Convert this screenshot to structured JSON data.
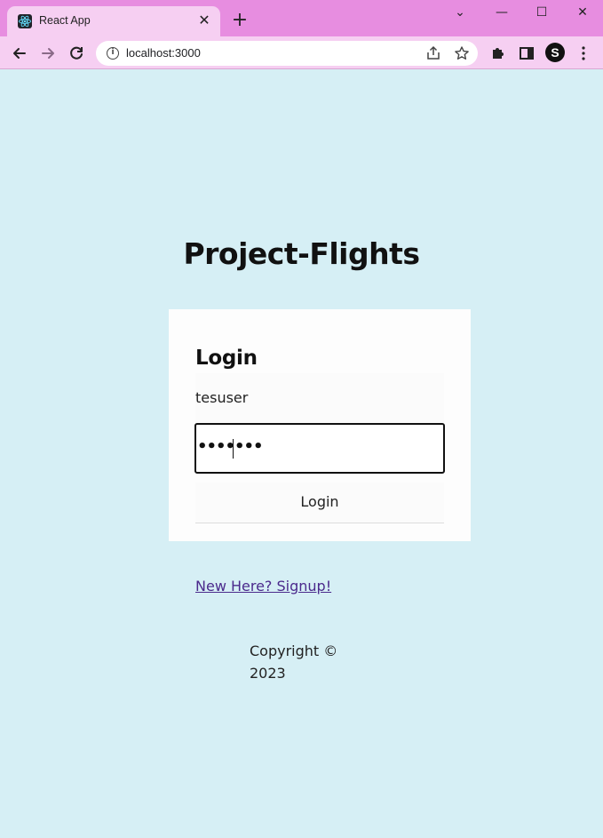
{
  "browser": {
    "tab_title": "React App",
    "tab_close": "✕",
    "new_tab": "+",
    "url": "localhost:3000",
    "profile_initial": "S",
    "window_controls": {
      "menu": "⌄",
      "minimize": "—",
      "maximize": "☐",
      "close": "✕"
    }
  },
  "page": {
    "title": "Project-Flights",
    "login": {
      "heading": "Login",
      "username_value": "tesuser",
      "password_mask": "•••••••",
      "button_label": "Login"
    },
    "signup_link": "New Here? Signup!",
    "copyright_line1": "Copyright ©",
    "copyright_line2": "2023"
  },
  "colors": {
    "page_background": "#d6eff5",
    "tabstrip": "#e78de0",
    "toolbar": "#f6cff2",
    "link": "#4b2a8c"
  }
}
